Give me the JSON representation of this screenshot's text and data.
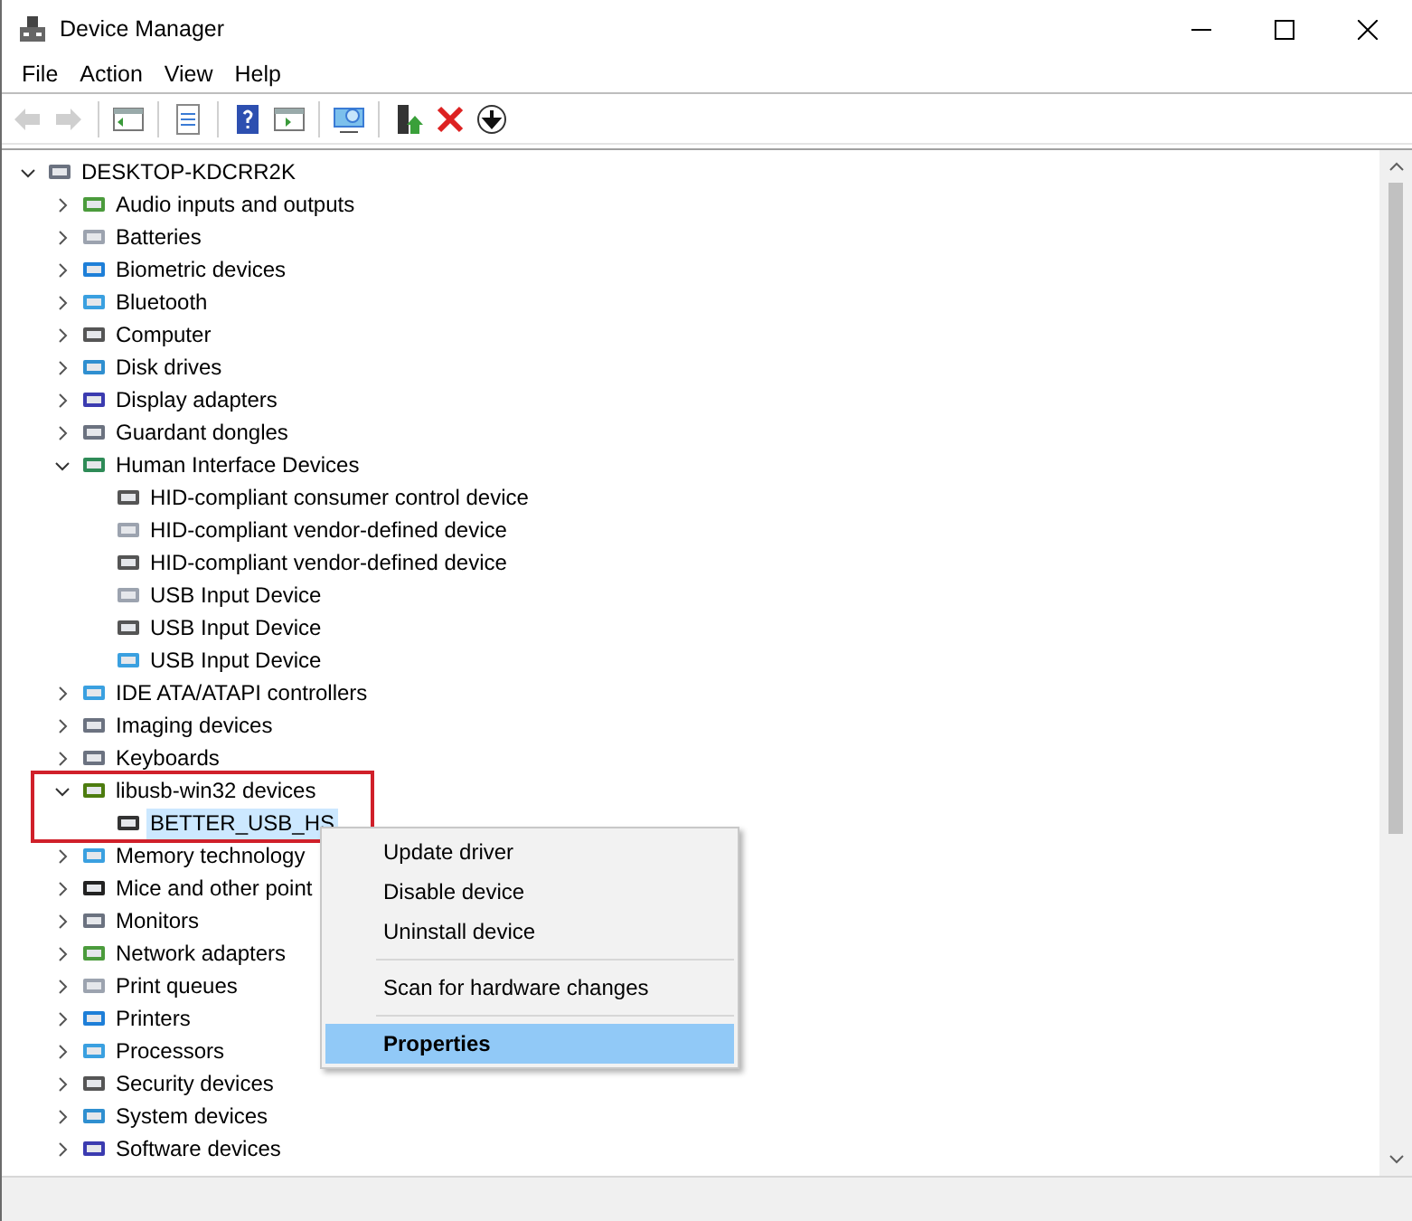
{
  "window": {
    "title": "Device Manager"
  },
  "menu_bar": [
    {
      "label": "File"
    },
    {
      "label": "Action"
    },
    {
      "label": "View"
    },
    {
      "label": "Help"
    }
  ],
  "toolbar": [
    {
      "kind": "back",
      "disabled": true
    },
    {
      "kind": "forward",
      "disabled": true
    },
    {
      "kind": "sep"
    },
    {
      "kind": "tree",
      "disabled": false
    },
    {
      "kind": "sep"
    },
    {
      "kind": "props",
      "disabled": false
    },
    {
      "kind": "sep"
    },
    {
      "kind": "help",
      "disabled": false
    },
    {
      "kind": "pane",
      "disabled": false
    },
    {
      "kind": "sep"
    },
    {
      "kind": "scan",
      "disabled": false
    },
    {
      "kind": "sep"
    },
    {
      "kind": "update",
      "disabled": false
    },
    {
      "kind": "remove",
      "disabled": false
    },
    {
      "kind": "download",
      "disabled": false
    }
  ],
  "tree": [
    {
      "label": "DESKTOP-KDCRR2K",
      "expanded": true,
      "selected": false,
      "children": [
        {
          "label": "Audio inputs and outputs",
          "expanded": false,
          "selected": false
        },
        {
          "label": "Batteries",
          "expanded": false,
          "selected": false
        },
        {
          "label": "Biometric devices",
          "expanded": false,
          "selected": false
        },
        {
          "label": "Bluetooth",
          "expanded": false,
          "selected": false
        },
        {
          "label": "Computer",
          "expanded": false,
          "selected": false
        },
        {
          "label": "Disk drives",
          "expanded": false,
          "selected": false
        },
        {
          "label": "Display adapters",
          "expanded": false,
          "selected": false
        },
        {
          "label": "Guardant dongles",
          "expanded": false,
          "selected": false
        },
        {
          "label": "Human Interface Devices",
          "expanded": true,
          "selected": false,
          "children": [
            {
              "label": "HID-compliant consumer control device",
              "selected": false
            },
            {
              "label": "HID-compliant vendor-defined device",
              "selected": false
            },
            {
              "label": "HID-compliant vendor-defined device",
              "selected": false
            },
            {
              "label": "USB Input Device",
              "selected": false
            },
            {
              "label": "USB Input Device",
              "selected": false
            },
            {
              "label": "USB Input Device",
              "selected": false
            }
          ]
        },
        {
          "label": "IDE ATA/ATAPI controllers",
          "expanded": false,
          "selected": false
        },
        {
          "label": "Imaging devices",
          "expanded": false,
          "selected": false
        },
        {
          "label": "Keyboards",
          "expanded": false,
          "selected": false
        },
        {
          "label": "libusb-win32 devices",
          "expanded": true,
          "selected": false,
          "children": [
            {
              "label": "BETTER_USB_HS",
              "selected": true
            }
          ]
        },
        {
          "label": "Memory technology",
          "expanded": false,
          "selected": false
        },
        {
          "label": "Mice and other point",
          "expanded": false,
          "selected": false
        },
        {
          "label": "Monitors",
          "expanded": false,
          "selected": false
        },
        {
          "label": "Network adapters",
          "expanded": false,
          "selected": false
        },
        {
          "label": "Print queues",
          "expanded": false,
          "selected": false
        },
        {
          "label": "Printers",
          "expanded": false,
          "selected": false
        },
        {
          "label": "Processors",
          "expanded": false,
          "selected": false
        },
        {
          "label": "Security devices",
          "expanded": false,
          "selected": false
        },
        {
          "label": "System devices",
          "expanded": false,
          "selected": false
        },
        {
          "label": "Software devices",
          "expanded": false,
          "selected": false
        }
      ]
    }
  ],
  "context_menu": [
    {
      "kind": "item",
      "label": "Update driver",
      "selected": false,
      "default": false
    },
    {
      "kind": "item",
      "label": "Disable device",
      "selected": false,
      "default": false
    },
    {
      "kind": "item",
      "label": "Uninstall device",
      "selected": false,
      "default": false
    },
    {
      "kind": "separator"
    },
    {
      "kind": "item",
      "label": "Scan for hardware changes",
      "selected": false,
      "default": false
    },
    {
      "kind": "separator"
    },
    {
      "kind": "item",
      "label": "Properties",
      "selected": true,
      "default": true
    }
  ]
}
